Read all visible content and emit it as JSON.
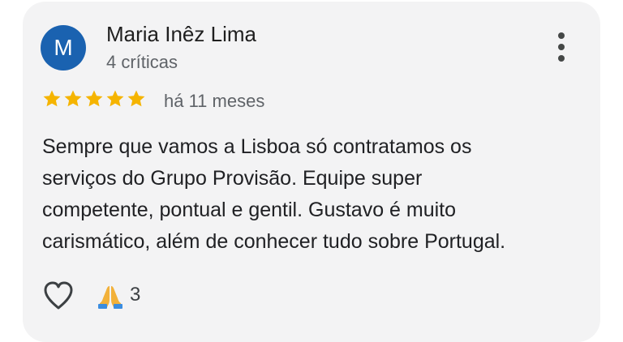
{
  "review": {
    "author": {
      "initial": "M",
      "name": "Maria Inêz Lima",
      "review_count": "4 críticas",
      "avatar_color": "#1a62b0"
    },
    "rating": 5,
    "star_color": "#f5b400",
    "time": "há 11 meses",
    "text_lines": [
      "Sempre que vamos a Lisboa só contratamos os",
      "serviços do Grupo Provisão. Equipe super",
      "competente, pontual e gentil. Gustavo é muito",
      "carismático, além de conhecer tudo sobre Portugal."
    ],
    "actions": {
      "like_icon": "heart-icon",
      "reaction_icon": "folded-hands-icon",
      "reaction_count": "3"
    },
    "more_icon": "more-vert-icon"
  }
}
